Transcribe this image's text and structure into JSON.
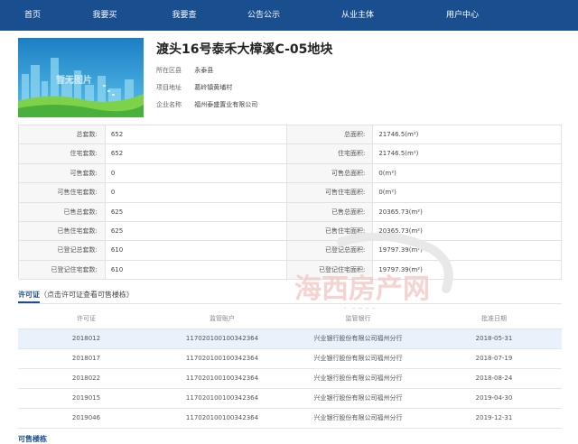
{
  "nav": {
    "items": [
      {
        "label": "首页"
      },
      {
        "label": "我要买"
      },
      {
        "label": "我要查"
      },
      {
        "label": "公告公示"
      },
      {
        "label": "从业主体"
      },
      {
        "label": "用户中心"
      }
    ]
  },
  "project": {
    "image_caption": "暂无图片",
    "title": "渡头16号泰禾大樟溪C-05地块",
    "meta": [
      {
        "key": "所在区县",
        "value": "永泰县"
      },
      {
        "key": "项目地址",
        "value": "葛岭镇黄埔村"
      },
      {
        "key": "企业名称",
        "value": "福州泰盛置业有限公司"
      }
    ]
  },
  "stats": {
    "rows": [
      {
        "l1": "总套数:",
        "v1": "652",
        "l2": "总面积:",
        "v2": "21746.5(m²)"
      },
      {
        "l1": "住宅套数:",
        "v1": "652",
        "l2": "住宅面积:",
        "v2": "21746.5(m²)"
      },
      {
        "l1": "可售套数:",
        "v1": "0",
        "l2": "可售总面积:",
        "v2": "0(m²)"
      },
      {
        "l1": "可售住宅套数:",
        "v1": "0",
        "l2": "可售住宅面积:",
        "v2": "0(m²)"
      },
      {
        "l1": "已售总套数:",
        "v1": "625",
        "l2": "已售总面积:",
        "v2": "20365.73(m²)"
      },
      {
        "l1": "已售住宅套数:",
        "v1": "625",
        "l2": "已售住宅面积:",
        "v2": "20365.73(m²)"
      },
      {
        "l1": "已登记总套数:",
        "v1": "610",
        "l2": "已登记总面积:",
        "v2": "19797.39(m²)"
      },
      {
        "l1": "已登记住宅套数:",
        "v1": "610",
        "l2": "已登记住宅面积:",
        "v2": "19797.39(m²)"
      }
    ]
  },
  "permits": {
    "title": "许可证",
    "hint": "（点击许可证查看可售楼栋）",
    "headers": [
      "许可证",
      "监管账户",
      "监管银行",
      "批准日期"
    ],
    "rows": [
      [
        "2018012",
        "117020100100342364",
        "兴业银行股份有限公司福州分行",
        "2018-05-31"
      ],
      [
        "2018017",
        "117020100100342364",
        "兴业银行股份有限公司福州分行",
        "2018-07-19"
      ],
      [
        "2018022",
        "117020100100342364",
        "兴业银行股份有限公司福州分行",
        "2018-08-24"
      ],
      [
        "2019015",
        "117020100100342364",
        "兴业银行股份有限公司福州分行",
        "2019-04-30"
      ],
      [
        "2019046",
        "117020100100342364",
        "兴业银行股份有限公司福州分行",
        "2019-12-31"
      ]
    ]
  },
  "sale_section": {
    "title": "可售楼栋"
  },
  "watermark": {
    "name": "海西房产网",
    "url": "www.h0591.com"
  },
  "colors": {
    "nav_bg": "#1a4f8f",
    "accent": "#1a4f8f",
    "row_highlight": "#e9f1fb",
    "watermark": "#d9534f"
  }
}
